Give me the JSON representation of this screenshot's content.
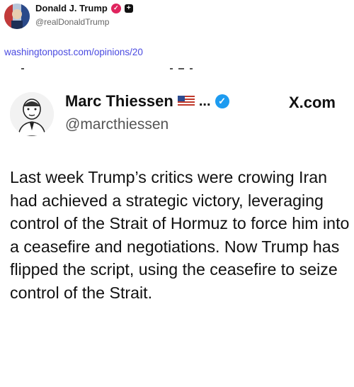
{
  "post": {
    "author_name": "Donald J. Trump",
    "author_handle": "@realDonaldTrump",
    "link_text": "washingtonpost.com/opinions/20"
  },
  "embed": {
    "name": "Marc Thiessen",
    "ellipsis": "...",
    "handle": "@marcthiessen",
    "source": "X.com",
    "text": "Last week Trump’s critics were crowing Iran had achieved a strategic victory, leveraging control of the Strait of Hormuz to force him into a ceasefire and negotiations. Now Trump has flipped the script, using the ceasefire to seize control of the Strait."
  },
  "icons": {
    "verified_main": "verified-badge-icon",
    "plus": "plus-badge-icon",
    "flag": "us-flag-icon",
    "verified_embed": "blue-check-icon"
  },
  "colors": {
    "link": "#4a4ae0",
    "verified_main": "#e0245e",
    "verified_embed": "#1d9bf0"
  }
}
